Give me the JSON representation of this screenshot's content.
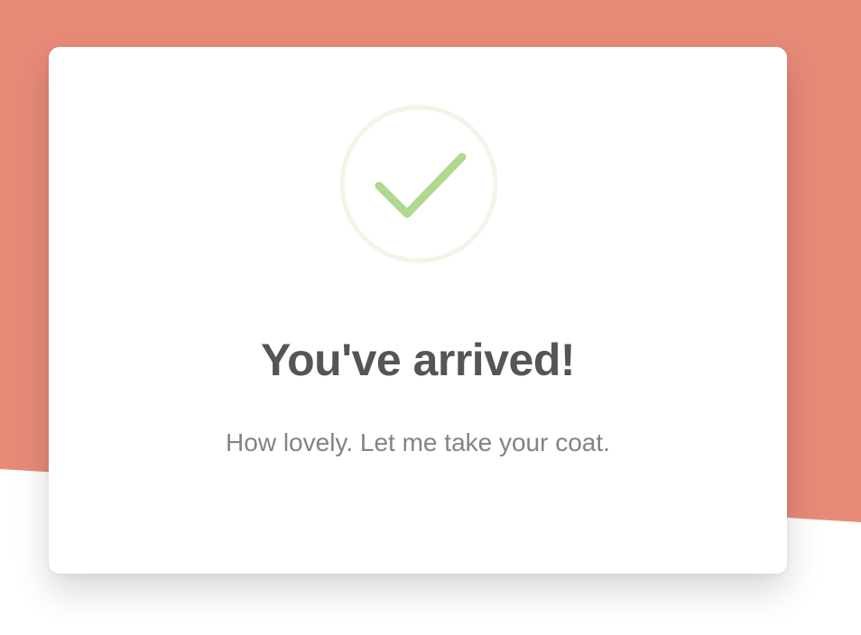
{
  "success_card": {
    "icon": "checkmark-icon",
    "title": "You've arrived!",
    "message": "How lovely. Let me take your coat."
  },
  "colors": {
    "backdrop": "#e88a78",
    "card": "#ffffff",
    "check_ring": "#eef7e8",
    "check_mark": "#aed98f",
    "title_text": "#555555",
    "message_text": "#838383"
  }
}
